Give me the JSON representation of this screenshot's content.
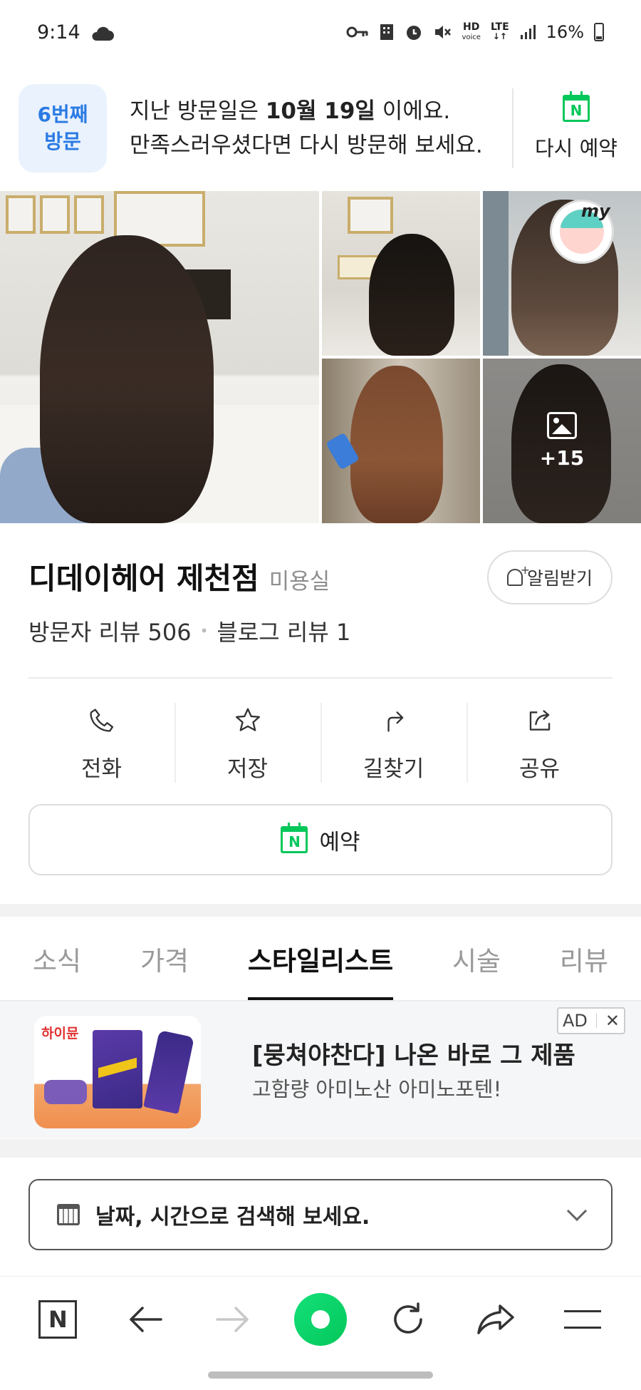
{
  "status_bar": {
    "time": "9:14",
    "battery": "16%",
    "network_hd": "HD",
    "network_hd_sub": "voice",
    "network_lte": "LTE",
    "icons": [
      "cloud-icon",
      "key-icon",
      "building-icon",
      "alarm-icon",
      "mute-icon",
      "signal-icon",
      "battery-icon"
    ]
  },
  "visit_banner": {
    "badge_line1": "6번째",
    "badge_line2": "방문",
    "text_prefix": "지난 방문일은 ",
    "text_date": "10월 19일",
    "text_suffix": " 이에요.",
    "text_line2": "만족스러우셨다면 다시 방문해 보세요.",
    "revisit_label": "다시 예약",
    "revisit_icon_letter": "N"
  },
  "gallery": {
    "more_count": "+15",
    "avatar_label": "my"
  },
  "place": {
    "name": "디데이헤어 제천점",
    "category": "미용실",
    "alarm_label": "알림받기",
    "visitor_reviews": "방문자 리뷰 506",
    "blog_reviews": "블로그 리뷰 1",
    "separator": "•"
  },
  "actions": {
    "call": "전화",
    "save": "저장",
    "directions": "길찾기",
    "share": "공유",
    "reserve": "예약",
    "reserve_icon_letter": "N"
  },
  "tabs": [
    "소식",
    "가격",
    "스타일리스트",
    "시술",
    "리뷰"
  ],
  "active_tab": "스타일리스트",
  "ad": {
    "brand": "하이뮨",
    "title": "[뭉쳐야찬다] 나온 바로 그 제품",
    "subtitle": "고함량 아미노산 아미노포텐!",
    "badge": "AD",
    "close": "✕"
  },
  "date_search": {
    "placeholder": "날짜, 시간으로 검색해 보세요."
  },
  "bottom_bar": {
    "home_letter": "N"
  },
  "colors": {
    "naver_green": "#03c75a",
    "badge_blue": "#2b7be4",
    "badge_bg": "#eaf2fd"
  }
}
